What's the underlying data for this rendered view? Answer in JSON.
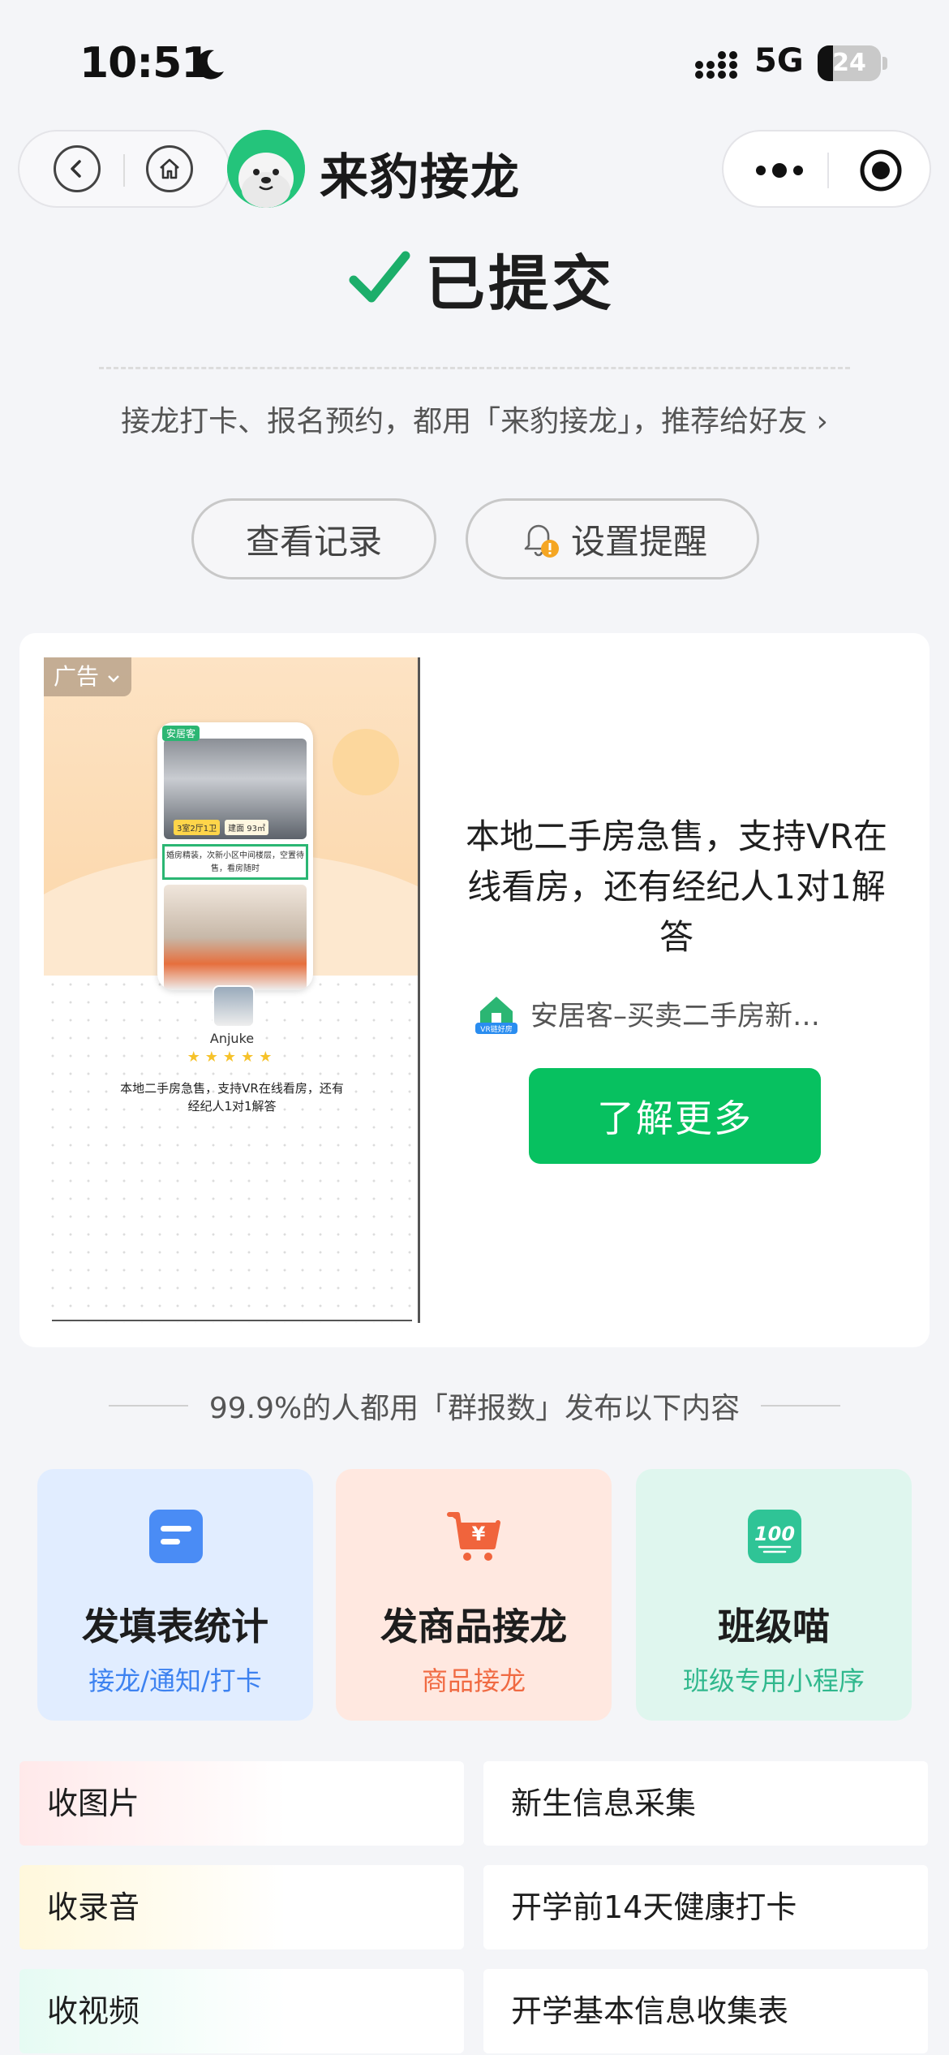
{
  "status_bar": {
    "time": "10:51",
    "network": "5G",
    "battery": "24",
    "battery_level": 0.24
  },
  "nav": {
    "app_title": "来豹接龙"
  },
  "result": {
    "title": "已提交",
    "recommend": "接龙打卡、报名预约，都用「来豹接龙」，推荐给好友 ›",
    "view_records": "查看记录",
    "set_reminder": "设置提醒"
  },
  "ad": {
    "tag": "广告",
    "phone_brand": "安居客",
    "phone_tag_1": "3室2厅1卫",
    "phone_tag_2": "建面 93㎡",
    "phone_desc": "婚房精装，次新小区中间楼层，空置待售，看房随时",
    "brand_name": "Anjuke",
    "stars": "★★★★★",
    "image_text": "本地二手房急售，支持VR在线看房，还有经纪人1对1解答",
    "headline": "本地二手房急售，支持VR在线看房，还有经纪人1对1解答",
    "source": "安居客–买卖二手房新…",
    "source_icon_text": "VR链好房",
    "cta": "了解更多"
  },
  "section_title": "99.9%的人都用「群报数」发布以下内容",
  "features": [
    {
      "title": "发填表统计",
      "sub": "接龙/通知/打卡",
      "icon": "form-icon"
    },
    {
      "title": "发商品接龙",
      "sub": "商品接龙",
      "icon": "cart-yen-icon"
    },
    {
      "title": "班级喵",
      "sub": "班级专用小程序",
      "icon": "score-100-icon"
    }
  ],
  "tiles": {
    "left": [
      "收图片",
      "收录音",
      "收视频"
    ],
    "right": [
      "新生信息采集",
      "开学前14天健康打卡",
      "开学基本信息收集表"
    ]
  }
}
